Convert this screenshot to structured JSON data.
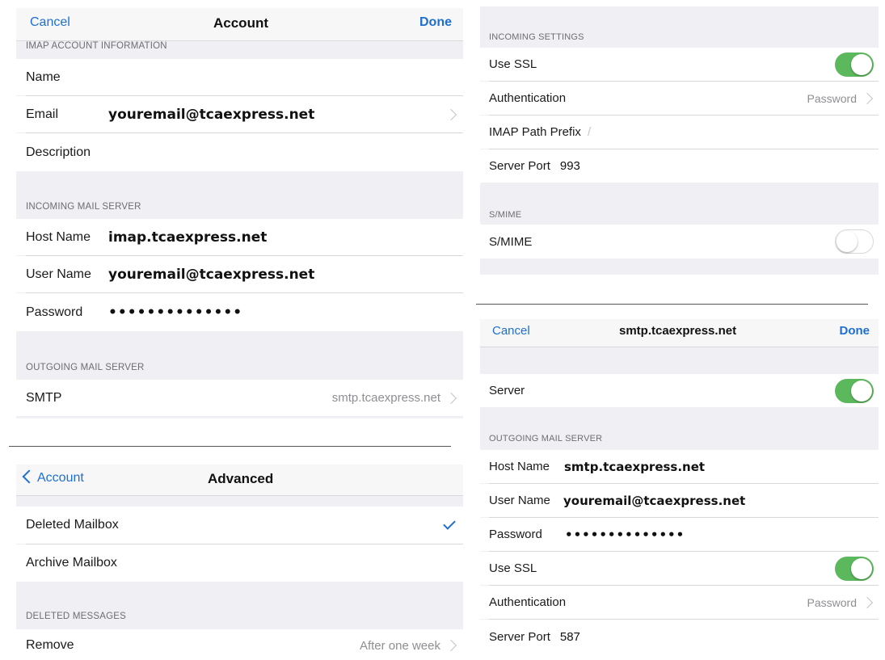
{
  "account_panel": {
    "nav": {
      "cancel": "Cancel",
      "title": "Account",
      "done": "Done"
    },
    "imap_header": "IMAP ACCOUNT INFORMATION",
    "name_label": "Name",
    "email_label": "Email",
    "email_value": "youremail@tcaexpress.net",
    "description_label": "Description",
    "incoming_header": "INCOMING MAIL SERVER",
    "host_label": "Host Name",
    "host_value": "imap.tcaexpress.net",
    "user_label": "User Name",
    "user_value": "youremail@tcaexpress.net",
    "password_label": "Password",
    "password_value": "••••••••••••••",
    "outgoing_header": "OUTGOING MAIL SERVER",
    "smtp_label": "SMTP",
    "smtp_value": "smtp.tcaexpress.net"
  },
  "advanced_panel": {
    "nav": {
      "back": "Account",
      "title": "Advanced"
    },
    "deleted_mailbox": "Deleted Mailbox",
    "archive_mailbox": "Archive Mailbox",
    "deleted_header": "DELETED MESSAGES",
    "remove_label": "Remove",
    "remove_value": "After one week"
  },
  "incoming_settings_panel": {
    "header": "INCOMING SETTINGS",
    "ssl_label": "Use SSL",
    "ssl_on": true,
    "auth_label": "Authentication",
    "auth_value": "Password",
    "prefix_label": "IMAP Path Prefix",
    "prefix_value": "/",
    "port_label": "Server Port",
    "port_value": "993",
    "smime_header": "S/MIME",
    "smime_label": "S/MIME",
    "smime_on": false
  },
  "smtp_panel": {
    "nav": {
      "cancel": "Cancel",
      "title": "smtp.tcaexpress.net",
      "done": "Done"
    },
    "server_label": "Server",
    "server_on": true,
    "outgoing_header": "OUTGOING MAIL SERVER",
    "host_label": "Host Name",
    "host_value": "smtp.tcaexpress.net",
    "user_label": "User Name",
    "user_value": "youremail@tcaexpress.net",
    "password_label": "Password",
    "password_value": "••••••••••••••",
    "ssl_label": "Use SSL",
    "ssl_on": true,
    "auth_label": "Authentication",
    "auth_value": "Password",
    "port_label": "Server Port",
    "port_value": "587"
  },
  "colors": {
    "accent": "#1e6fd0",
    "toggle_on": "#5cb85c",
    "group_bg": "#efeff4"
  }
}
